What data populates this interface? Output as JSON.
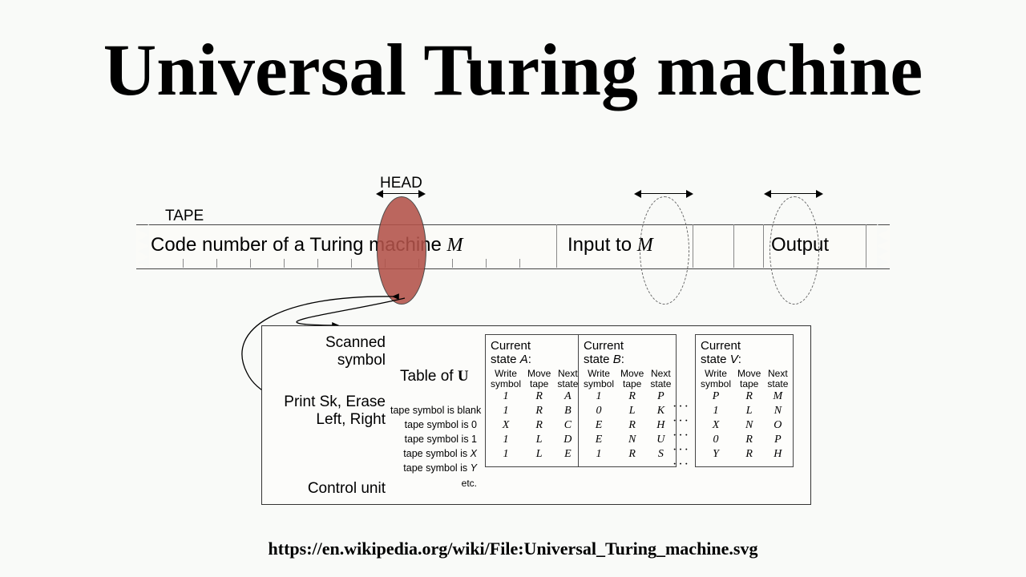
{
  "title": "Universal Turing machine",
  "source_url": "https://en.wikipedia.org/wiki/File:Universal_Turing_machine.svg",
  "labels": {
    "head": "HEAD",
    "tape": "TAPE",
    "tape_segment1_prefix": "Code number of a Turing machine ",
    "tape_segment1_M": "M",
    "tape_segment2_prefix": "Input to ",
    "tape_segment2_M": "M",
    "tape_segment3": "Output",
    "scanned_symbol": "Scanned\nsymbol",
    "print_sk": "Print Sk, Erase\nLeft, Right",
    "control_unit": "Control unit",
    "table_of": "Table of ",
    "table_of_U": "U",
    "etc": "etc.",
    "dots": "· · ·"
  },
  "row_labels": [
    "tape symbol is blank",
    "tape symbol is 0",
    "tape symbol is 1",
    "tape symbol is X",
    "tape symbol is Y"
  ],
  "col_headers": [
    "Write\nsymbol",
    "Move\ntape",
    "Next\nstate"
  ],
  "states": [
    {
      "name": "A",
      "rows": [
        [
          "1",
          "R",
          "A"
        ],
        [
          "1",
          "R",
          "B"
        ],
        [
          "X",
          "R",
          "C"
        ],
        [
          "1",
          "L",
          "D"
        ],
        [
          "1",
          "L",
          "E"
        ]
      ]
    },
    {
      "name": "B",
      "rows": [
        [
          "1",
          "R",
          "P"
        ],
        [
          "0",
          "L",
          "K"
        ],
        [
          "E",
          "R",
          "H"
        ],
        [
          "E",
          "N",
          "U"
        ],
        [
          "1",
          "R",
          "S"
        ]
      ]
    },
    {
      "name": "V",
      "rows": [
        [
          "P",
          "R",
          "M"
        ],
        [
          "1",
          "L",
          "N"
        ],
        [
          "X",
          "N",
          "O"
        ],
        [
          "0",
          "R",
          "P"
        ],
        [
          "Y",
          "R",
          "H"
        ]
      ]
    }
  ]
}
